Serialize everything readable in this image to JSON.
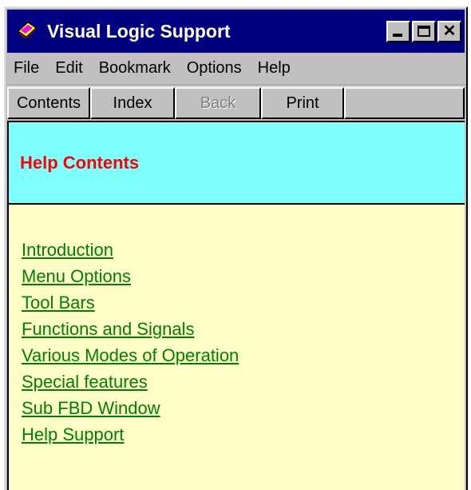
{
  "window": {
    "title": "Visual Logic Support",
    "icon": "book-icon"
  },
  "menubar": {
    "items": [
      "File",
      "Edit",
      "Bookmark",
      "Options",
      "Help"
    ]
  },
  "toolbar": {
    "contents_label": "Contents",
    "index_label": "Index",
    "back_label": "Back",
    "back_enabled": false,
    "print_label": "Print"
  },
  "content": {
    "title": "Help Contents",
    "links": [
      "Introduction",
      "Menu Options",
      "Tool Bars",
      "Functions and Signals",
      "Various Modes of Operation",
      "Special features",
      "Sub FBD Window",
      "Help Support"
    ]
  },
  "colors": {
    "title_bar": "#000080",
    "header_band": "#80ffff",
    "page_background": "#ffffc8",
    "title_text": "#ff0000",
    "link_text": "#008000"
  }
}
